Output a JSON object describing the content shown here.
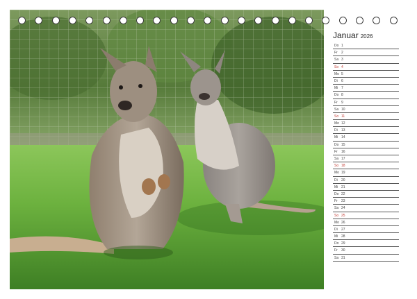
{
  "calendar": {
    "month": "Januar",
    "year": "2026",
    "photo_subject": "Two kangaroos standing on green grass in front of a wire fence",
    "accent_color": "#c23b32",
    "days": [
      {
        "wd": "Do",
        "d": "1",
        "sun": false
      },
      {
        "wd": "Fr",
        "d": "2",
        "sun": false
      },
      {
        "wd": "Sa",
        "d": "3",
        "sun": false
      },
      {
        "wd": "So",
        "d": "4",
        "sun": true
      },
      {
        "wd": "Mo",
        "d": "5",
        "sun": false
      },
      {
        "wd": "Di",
        "d": "6",
        "sun": false
      },
      {
        "wd": "Mi",
        "d": "7",
        "sun": false
      },
      {
        "wd": "Do",
        "d": "8",
        "sun": false
      },
      {
        "wd": "Fr",
        "d": "9",
        "sun": false
      },
      {
        "wd": "Sa",
        "d": "10",
        "sun": false
      },
      {
        "wd": "So",
        "d": "11",
        "sun": true
      },
      {
        "wd": "Mo",
        "d": "12",
        "sun": false
      },
      {
        "wd": "Di",
        "d": "13",
        "sun": false
      },
      {
        "wd": "Mi",
        "d": "14",
        "sun": false
      },
      {
        "wd": "Do",
        "d": "15",
        "sun": false
      },
      {
        "wd": "Fr",
        "d": "16",
        "sun": false
      },
      {
        "wd": "Sa",
        "d": "17",
        "sun": false
      },
      {
        "wd": "So",
        "d": "18",
        "sun": true
      },
      {
        "wd": "Mo",
        "d": "19",
        "sun": false
      },
      {
        "wd": "Di",
        "d": "20",
        "sun": false
      },
      {
        "wd": "Mi",
        "d": "21",
        "sun": false
      },
      {
        "wd": "Do",
        "d": "22",
        "sun": false
      },
      {
        "wd": "Fr",
        "d": "23",
        "sun": false
      },
      {
        "wd": "Sa",
        "d": "24",
        "sun": false
      },
      {
        "wd": "So",
        "d": "25",
        "sun": true
      },
      {
        "wd": "Mo",
        "d": "26",
        "sun": false
      },
      {
        "wd": "Di",
        "d": "27",
        "sun": false
      },
      {
        "wd": "Mi",
        "d": "28",
        "sun": false
      },
      {
        "wd": "Do",
        "d": "29",
        "sun": false
      },
      {
        "wd": "Fr",
        "d": "30",
        "sun": false
      },
      {
        "wd": "Sa",
        "d": "31",
        "sun": false
      }
    ]
  }
}
